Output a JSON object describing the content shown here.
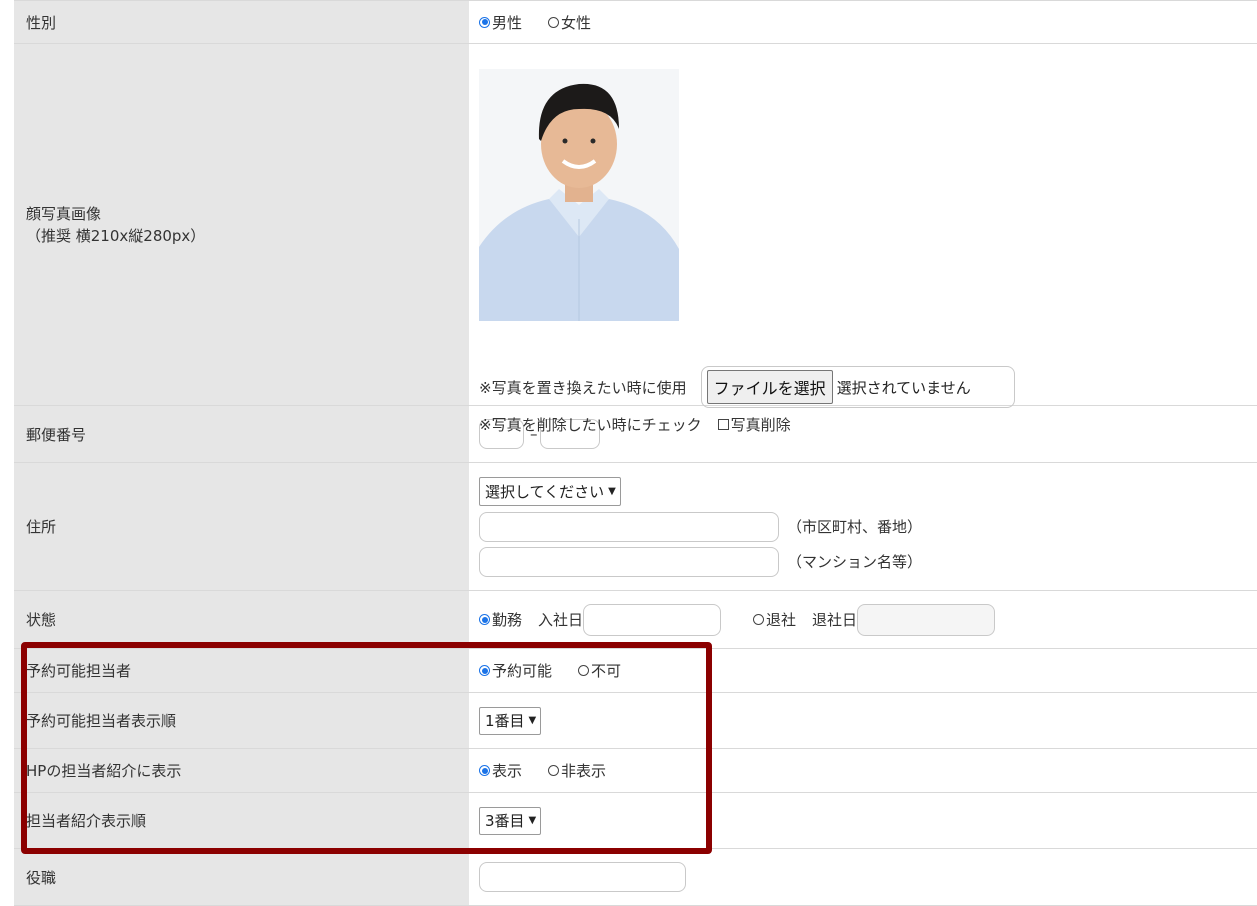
{
  "gender": {
    "label": "性別",
    "options": [
      "男性",
      "女性"
    ],
    "selected": 0
  },
  "photo": {
    "label_line1": "顔写真画像",
    "label_line2": "（推奨 横210x縦280px）",
    "replace_note": "※写真を置き換えたい時に使用",
    "file_button": "ファイルを選択",
    "file_status": "選択されていません",
    "delete_note": "※写真を削除したい時にチェック",
    "delete_checkbox": "写真削除",
    "colors": {
      "background": "#f4f6f8",
      "shirt": "#c8d8ee",
      "hair": "#1c1a19",
      "skin": "#e7b996"
    }
  },
  "postal": {
    "label": "郵便番号",
    "separator": "–"
  },
  "address": {
    "label": "住所",
    "prefecture_select": "選択してください",
    "city_hint": "（市区町村、番地）",
    "building_hint": "（マンション名等）"
  },
  "status": {
    "label": "状態",
    "option_active": "勤務",
    "join_date_label": "入社日",
    "option_retired": "退社",
    "leave_date_label": "退社日",
    "selected": "active"
  },
  "bookable": {
    "label": "予約可能担当者",
    "options": [
      "予約可能",
      "不可"
    ],
    "selected": 0
  },
  "bookable_order": {
    "label": "予約可能担当者表示順",
    "value": "1番目"
  },
  "hp_display": {
    "label": "HPの担当者紹介に表示",
    "options": [
      "表示",
      "非表示"
    ],
    "selected": 0
  },
  "intro_order": {
    "label": "担当者紹介表示順",
    "value": "3番目"
  },
  "position": {
    "label": "役職"
  },
  "colors": {
    "label_bg": "#e6e6e6",
    "radio_accent": "#1a73e8",
    "highlight_border": "#8b0000"
  }
}
